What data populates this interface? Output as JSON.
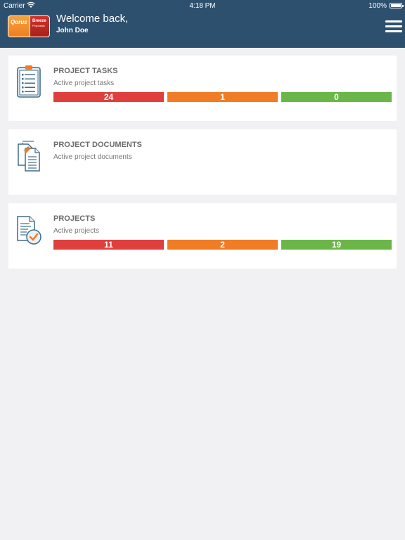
{
  "status_bar": {
    "carrier": "Carrier",
    "time": "4:18 PM",
    "battery": "100%"
  },
  "header": {
    "logo_left": "Qorus",
    "logo_right_line1": "Breeze",
    "logo_right_line2": "Proposals",
    "welcome": "Welcome back,",
    "username": "John Doe",
    "menu_icon": "hamburger-menu-icon"
  },
  "cards": [
    {
      "title": "PROJECT TASKS",
      "subtitle": "Active project tasks",
      "icon": "clipboard-list-icon",
      "counts": {
        "red": "24",
        "orange": "1",
        "green": "0"
      }
    },
    {
      "title": "PROJECT DOCUMENTS",
      "subtitle": "Active project documents",
      "icon": "documents-icon"
    },
    {
      "title": "PROJECTS",
      "subtitle": "Active projects",
      "icon": "document-check-icon",
      "counts": {
        "red": "11",
        "orange": "2",
        "green": "19"
      }
    }
  ],
  "colors": {
    "header_bg": "#2e506f",
    "red": "#e0403d",
    "orange": "#f07c25",
    "green": "#6ab648"
  }
}
